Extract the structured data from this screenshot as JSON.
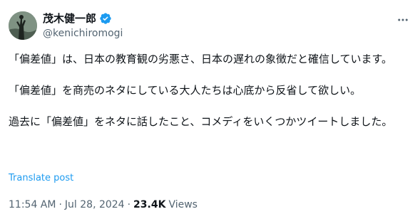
{
  "author": {
    "display_name": "茂木健一郎",
    "handle": "@kenichiromogi",
    "avatar_icon": "profile-photo",
    "verified_icon": "verified-badge-icon",
    "verified_color": "#1d9bf0"
  },
  "more_icon": "more-horizontal-icon",
  "tweet": {
    "paragraphs": [
      "「偏差値」は、日本の教育観の劣悪さ、日本の遅れの象徴だと確信しています。",
      "「偏差値」を商売のネタにしている大人たちは心底から反省して欲しい。",
      "過去に「偏差値」をネタに話したこと、コメディをいくつかツイートしました。"
    ]
  },
  "translate_label": "Translate post",
  "meta": {
    "time": "11:54 AM",
    "separator": "·",
    "date": "Jul 28, 2024",
    "views_count": "23.4K",
    "views_label": "Views"
  },
  "colors": {
    "text": "#0f1419",
    "secondary": "#536471",
    "link": "#1d9bf0"
  }
}
